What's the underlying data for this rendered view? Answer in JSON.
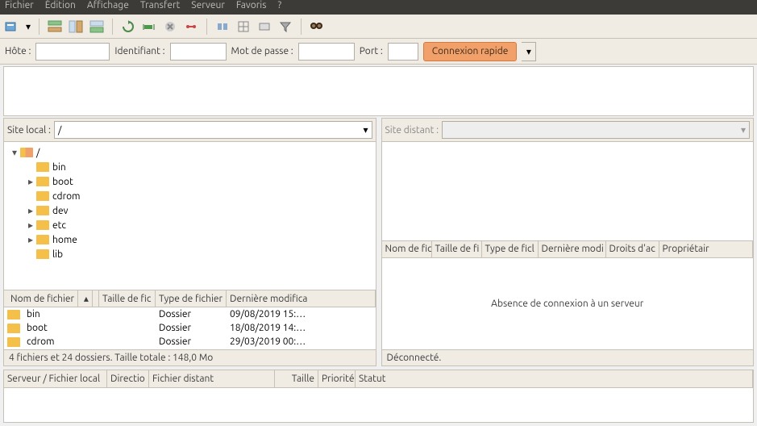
{
  "menu": {
    "items": [
      "Fichier",
      "Édition",
      "Affichage",
      "Transfert",
      "Serveur",
      "Favoris",
      "?"
    ]
  },
  "quick": {
    "host_label": "Hôte :",
    "user_label": "Identifiant :",
    "pass_label": "Mot de passe :",
    "port_label": "Port :",
    "connect": "Connexion rapide"
  },
  "local": {
    "site_label": "Site local :",
    "path": "/",
    "tree": [
      {
        "name": "/",
        "depth": 0,
        "exp": "▾",
        "sel": true
      },
      {
        "name": "bin",
        "depth": 1,
        "exp": ""
      },
      {
        "name": "boot",
        "depth": 1,
        "exp": "▸"
      },
      {
        "name": "cdrom",
        "depth": 1,
        "exp": ""
      },
      {
        "name": "dev",
        "depth": 1,
        "exp": "▸"
      },
      {
        "name": "etc",
        "depth": 1,
        "exp": "▸"
      },
      {
        "name": "home",
        "depth": 1,
        "exp": "▸"
      },
      {
        "name": "lib",
        "depth": 1,
        "exp": ""
      }
    ],
    "cols": [
      "Nom de fichier",
      "Taille de fic",
      "Type de fichier",
      "Dernière modifica"
    ],
    "rows": [
      {
        "name": "bin",
        "type": "Dossier",
        "date": "09/08/2019 15:…"
      },
      {
        "name": "boot",
        "type": "Dossier",
        "date": "18/08/2019 14:…"
      },
      {
        "name": "cdrom",
        "type": "Dossier",
        "date": "29/03/2019 00:…"
      }
    ],
    "status": "4 fichiers et 24 dossiers. Taille totale : 148,0 Mo"
  },
  "remote": {
    "site_label": "Site distant :",
    "cols": [
      "Nom de fic",
      "Taille de fi",
      "Type de ficl",
      "Dernière modi",
      "Droits d'ac",
      "Propriétair"
    ],
    "empty": "Absence de connexion à un serveur",
    "status": "Déconnecté."
  },
  "queue": {
    "cols": [
      "Serveur / Fichier local",
      "Directio",
      "Fichier distant",
      "Taille",
      "Priorité",
      "Statut"
    ]
  }
}
